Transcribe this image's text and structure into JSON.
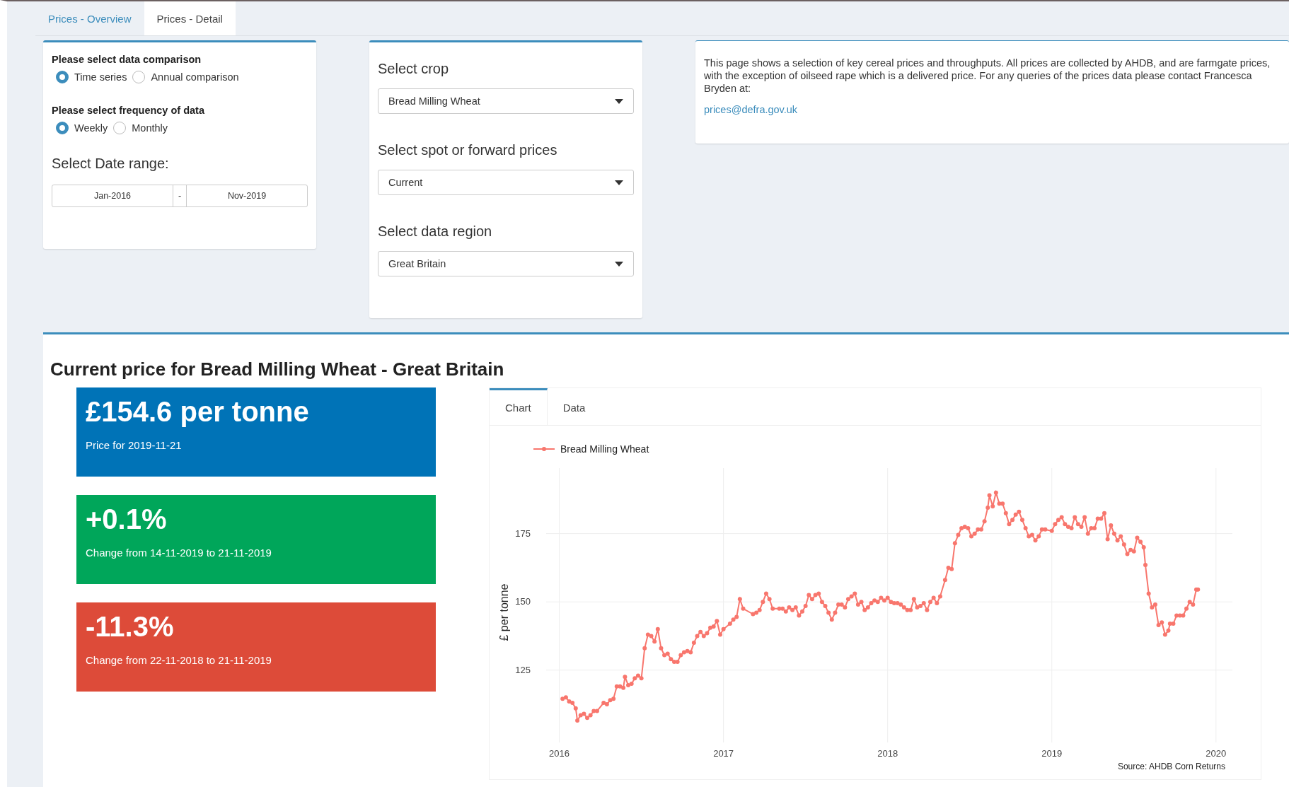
{
  "tabs": [
    {
      "label": "Prices - Overview",
      "selected": false
    },
    {
      "label": "Prices - Detail",
      "selected": true
    }
  ],
  "comparison": {
    "label": "Please select data comparison",
    "options": [
      {
        "label": "Time series",
        "selected": true
      },
      {
        "label": "Annual comparison",
        "selected": false
      }
    ]
  },
  "frequency": {
    "label": "Please select frequency of data",
    "options": [
      {
        "label": "Weekly",
        "selected": true
      },
      {
        "label": "Monthly",
        "selected": false
      }
    ]
  },
  "date_range": {
    "label": "Select Date range:",
    "start": "Jan-2016",
    "separator": "-",
    "end": "Nov-2019"
  },
  "selects": [
    {
      "label": "Select crop",
      "value": "Bread Milling Wheat"
    },
    {
      "label": "Select spot or forward prices",
      "value": "Current"
    },
    {
      "label": "Select data region",
      "value": "Great Britain"
    }
  ],
  "info": {
    "text": "This page shows a selection of key cereal prices and throughputs. All prices are collected by AHDB, and are farmgate prices, with the exception of oilseed rape which is a delivered price. For any queries of the prices data please contact Francesca Bryden at:",
    "email": "prices@defra.gov.uk"
  },
  "result": {
    "title": "Current price for Bread Milling Wheat - Great Britain",
    "value_boxes": [
      {
        "value": "£154.6 per tonne",
        "caption": "Price for 2019-11-21",
        "color": "#0073b7"
      },
      {
        "value": "+0.1%",
        "caption": "Change from 14-11-2019 to 21-11-2019",
        "color": "#00a65a"
      },
      {
        "value": "-11.3%",
        "caption": "Change from 22-11-2018 to 21-11-2019",
        "color": "#dd4b39"
      }
    ],
    "view_tabs": [
      {
        "label": "Chart",
        "selected": true
      },
      {
        "label": "Data",
        "selected": false
      }
    ],
    "chart_data": {
      "type": "line",
      "grid": true,
      "ylabel": "£ per tonne",
      "xlim": [
        2015.92,
        2020.1
      ],
      "ylim": [
        98.5,
        199
      ],
      "xticks": [
        2016,
        2017,
        2018,
        2019,
        2020
      ],
      "yticks": [
        125,
        150,
        175
      ],
      "annotations": [
        "Source: AHDB Corn Returns"
      ],
      "x": [
        2016.02,
        2016.04,
        2016.06,
        2016.08,
        2016.1,
        2016.11,
        2016.13,
        2016.15,
        2016.17,
        2016.19,
        2016.21,
        2016.23,
        2016.27,
        2016.29,
        2016.31,
        2016.33,
        2016.35,
        2016.37,
        2016.39,
        2016.4,
        2016.42,
        2016.44,
        2016.46,
        2016.48,
        2016.5,
        2016.52,
        2016.54,
        2016.56,
        2016.58,
        2016.6,
        2016.62,
        2016.64,
        2016.66,
        2016.68,
        2016.7,
        2016.72,
        2016.74,
        2016.76,
        2016.78,
        2016.8,
        2016.82,
        2016.84,
        2016.86,
        2016.88,
        2016.9,
        2016.92,
        2016.94,
        2016.96,
        2016.98,
        2017.0,
        2017.04,
        2017.06,
        2017.08,
        2017.1,
        2017.12,
        2017.18,
        2017.2,
        2017.22,
        2017.24,
        2017.26,
        2017.28,
        2017.3,
        2017.34,
        2017.36,
        2017.38,
        2017.4,
        2017.42,
        2017.44,
        2017.46,
        2017.48,
        2017.5,
        2017.52,
        2017.54,
        2017.56,
        2017.58,
        2017.6,
        2017.62,
        2017.64,
        2017.66,
        2017.68,
        2017.7,
        2017.72,
        2017.74,
        2017.76,
        2017.78,
        2017.8,
        2017.82,
        2017.84,
        2017.86,
        2017.88,
        2017.9,
        2017.92,
        2017.94,
        2017.96,
        2017.98,
        2018.0,
        2018.02,
        2018.04,
        2018.06,
        2018.08,
        2018.1,
        2018.12,
        2018.14,
        2018.16,
        2018.18,
        2018.2,
        2018.22,
        2018.24,
        2018.26,
        2018.28,
        2018.3,
        2018.32,
        2018.35,
        2018.37,
        2018.39,
        2018.41,
        2018.43,
        2018.45,
        2018.47,
        2018.49,
        2018.51,
        2018.53,
        2018.55,
        2018.57,
        2018.59,
        2018.61,
        2018.62,
        2018.64,
        2018.66,
        2018.68,
        2018.7,
        2018.72,
        2018.74,
        2018.76,
        2018.78,
        2018.8,
        2018.82,
        2018.84,
        2018.86,
        2018.88,
        2018.9,
        2018.92,
        2018.94,
        2018.96,
        2019.0,
        2019.02,
        2019.04,
        2019.06,
        2019.08,
        2019.1,
        2019.12,
        2019.14,
        2019.16,
        2019.18,
        2019.2,
        2019.22,
        2019.24,
        2019.26,
        2019.28,
        2019.3,
        2019.32,
        2019.34,
        2019.36,
        2019.38,
        2019.4,
        2019.42,
        2019.44,
        2019.46,
        2019.48,
        2019.5,
        2019.52,
        2019.54,
        2019.56,
        2019.57,
        2019.59,
        2019.61,
        2019.63,
        2019.65,
        2019.67,
        2019.69,
        2019.71,
        2019.72,
        2019.74,
        2019.76,
        2019.78,
        2019.8,
        2019.82,
        2019.84,
        2019.86,
        2019.88,
        2019.89
      ],
      "series": [
        {
          "name": "Bread Milling Wheat",
          "color": "#f8766d",
          "marker": true,
          "values": [
            114.5,
            115,
            113.5,
            113,
            111,
            106.5,
            108.5,
            109,
            107.5,
            108.5,
            110,
            110,
            113,
            112.5,
            114,
            114.5,
            119,
            119,
            118.5,
            122.5,
            119.5,
            120,
            122,
            123,
            122,
            133,
            138,
            137.5,
            135.5,
            140,
            133,
            130.5,
            131,
            129,
            128,
            128,
            130.5,
            131.5,
            132,
            131.5,
            135,
            137.5,
            139,
            137.5,
            138.5,
            140.5,
            141,
            143,
            138,
            140,
            142,
            143.5,
            144.5,
            151,
            147.5,
            145.5,
            146,
            147,
            150,
            153,
            151,
            147.5,
            147.5,
            147.5,
            146.5,
            148,
            147,
            148,
            145,
            146.5,
            148.5,
            152.5,
            151,
            152.5,
            153,
            150,
            148.5,
            146,
            143.5,
            146,
            149,
            149,
            148,
            151,
            152,
            153,
            149,
            150,
            147,
            148,
            149.5,
            150.5,
            150,
            151.5,
            150.5,
            151.5,
            150,
            149.5,
            149.5,
            149,
            148,
            147,
            147,
            151,
            148,
            148.5,
            149.5,
            147,
            150,
            151.5,
            149.5,
            152,
            158,
            162.5,
            162,
            171.5,
            174.5,
            177,
            177.5,
            177,
            174,
            175,
            176.5,
            176.5,
            179.5,
            184.5,
            189,
            185,
            190,
            186,
            186,
            182.5,
            178.5,
            180,
            182,
            183,
            180,
            177,
            174,
            174.5,
            172.5,
            174,
            176.5,
            176.5,
            176,
            178.5,
            180,
            181,
            178.5,
            177.5,
            177,
            181,
            178.5,
            177.5,
            181,
            175,
            177,
            177,
            180.5,
            180.5,
            182.5,
            173,
            178,
            175,
            172.5,
            174,
            171,
            167.5,
            169,
            168.5,
            173.5,
            172,
            170,
            163.5,
            153,
            148,
            149,
            141.5,
            142.5,
            138,
            139.5,
            142,
            142,
            145,
            145,
            145,
            147.5,
            150,
            149,
            154.5,
            154.5
          ]
        }
      ]
    }
  }
}
